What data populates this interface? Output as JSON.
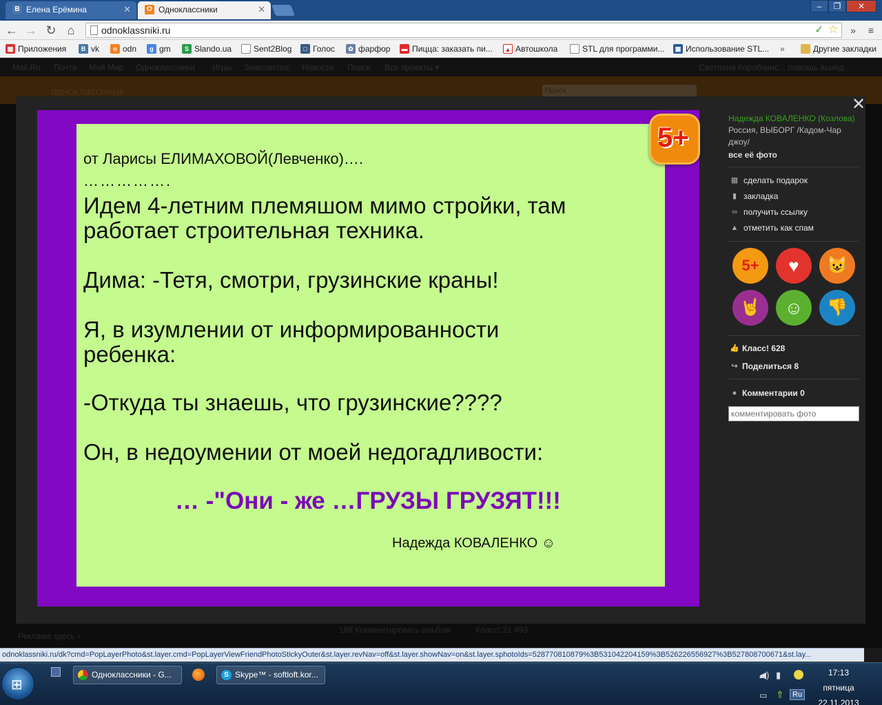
{
  "browser": {
    "tabs": [
      {
        "label": "Елена Ерёмина",
        "favicon": "vk-icon"
      },
      {
        "label": "Одноклассники",
        "favicon": "ok-icon"
      }
    ],
    "url": "odnoklassniki.ru",
    "bookmarks": [
      "Приложения",
      "vk",
      "odn",
      "gm",
      "Slando.ua",
      "Sent2Blog",
      "Голос",
      "фарфор",
      "Пицца: заказать пи...",
      "Автошкола",
      "STL для программи...",
      "Использование STL...",
      "Другие закладки"
    ],
    "status_url": "odnoklassniki.ru/dk?cmd=PopLayerPhoto&st.layer.cmd=PopLayerViewFriendPhotoStickyOuter&st.layer.revNav=off&st.layer.showNav=on&st.layer.sphotoIds=528770810879%3B531042204159%3B526226556927%3B527808700671&st.lay..."
  },
  "page_behind": {
    "nav": [
      "Mail.Ru",
      "Почта",
      "Мой Мир",
      "Одноклассники",
      "Игры",
      "Знакомства",
      "Новости",
      "Поиск",
      "Все проекты ▾"
    ],
    "user_links": "Светлана Коробчинс...   помощь   выход",
    "brand": "одноклассники",
    "search_placeholder": "Поиск",
    "footer_ad": "Реклама здесь ›",
    "footer_comments": "188 Комментировать альбом",
    "footer_class": "Класс! 21 493"
  },
  "photo": {
    "from": "от Ларисы ЕЛИМАХОВОЙ(Левченко)….",
    "dots": "…………….",
    "lines": [
      "Идем 4-летним племяшом мимо стройки, там",
      "работает строительная техника.",
      "Дима: -Тетя, смотри, грузинские краны!",
      "Я, в изумлении от информированности",
      "ребенка:",
      "-Откуда ты знаешь, что грузинские????",
      " Он, в недоумении от моей недогадливости:"
    ],
    "punchline": "… -\"Они - же …ГРУЗЫ ГРУЗЯТ!!!",
    "signature": "Надежда КОВАЛЕНКО ☺",
    "badge": "5+"
  },
  "sidebar": {
    "author_name": "Надежда КОВАЛЕНКО (Козлова)",
    "location_1": "Россия, ВЫБОРГ /Кадом-Чар",
    "location_2": "джоу/",
    "all_photos": "все её фото",
    "actions": [
      {
        "label": "сделать подарок",
        "icon": "gift-icon"
      },
      {
        "label": "закладка",
        "icon": "bookmark-icon"
      },
      {
        "label": "получить ссылку",
        "icon": "link-icon"
      },
      {
        "label": "отметить как спам",
        "icon": "warning-icon"
      }
    ],
    "reactions": [
      {
        "name": "five-plus",
        "glyph": "5+",
        "color": "#f39a12"
      },
      {
        "name": "heart",
        "glyph": "♥",
        "color": "#e2342c"
      },
      {
        "name": "cat",
        "glyph": "😺",
        "color": "#f07a22"
      },
      {
        "name": "rock",
        "glyph": "🤘",
        "color": "#9a2f92"
      },
      {
        "name": "hug",
        "glyph": "☺",
        "color": "#5bb12f"
      },
      {
        "name": "thumb-down",
        "glyph": "👎",
        "color": "#1d84c4"
      }
    ],
    "class_count": "Класс! 628",
    "share": "Поделиться 8",
    "comments": "Комментарии 0",
    "comment_placeholder": "комментировать фото"
  },
  "taskbar": {
    "buttons": [
      "Одноклассники - G...",
      "Skype™ - softloft.kor..."
    ],
    "lang": "Ru",
    "time": "17:13",
    "weekday": "пятница",
    "date": "22.11.2013"
  }
}
